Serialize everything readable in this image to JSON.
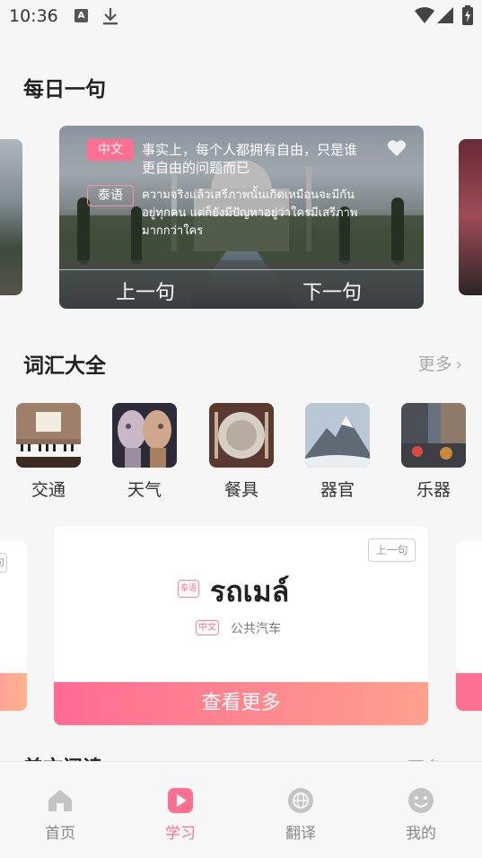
{
  "status_bar": {
    "time": "10:36",
    "a_icon": "A"
  },
  "daily": {
    "title": "每日一句",
    "tag_cn": "中文",
    "tag_th": "泰语",
    "cn_text": "事实上，每个人都拥有自由，只是谁更自由的问题而已",
    "th_text": "ความจริงแล้วเสรีภาพนั้นเกิดเหมือนจะมีกันอยู่ทุกคน แต่ก็ยังมีปัญหาอยู่ว่าใครมีเสรีภาพมากกว่าใคร",
    "prev": "上一句",
    "next": "下一句"
  },
  "vocab": {
    "title": "词汇大全",
    "more": "更多",
    "items": [
      {
        "label": "交通"
      },
      {
        "label": "天气"
      },
      {
        "label": "餐具"
      },
      {
        "label": "器官"
      },
      {
        "label": "乐器"
      }
    ]
  },
  "word_card": {
    "prev_pill": "上一句",
    "side_pill": "句",
    "thai_tag": "泰语",
    "thai_word": "รถเมล์",
    "zh_tag": "中文",
    "zh_word": "公共汽车",
    "see_more": "查看更多"
  },
  "section3": {
    "title": "美文阅读",
    "more": "更多"
  },
  "bottom_nav": {
    "items": [
      {
        "label": "首页",
        "icon": "home-icon"
      },
      {
        "label": "学习",
        "icon": "play-icon"
      },
      {
        "label": "翻译",
        "icon": "globe-icon"
      },
      {
        "label": "我的",
        "icon": "smile-icon"
      }
    ]
  },
  "colors": {
    "accent": "#ff6f92",
    "gradient_end": "#ffa08c"
  }
}
